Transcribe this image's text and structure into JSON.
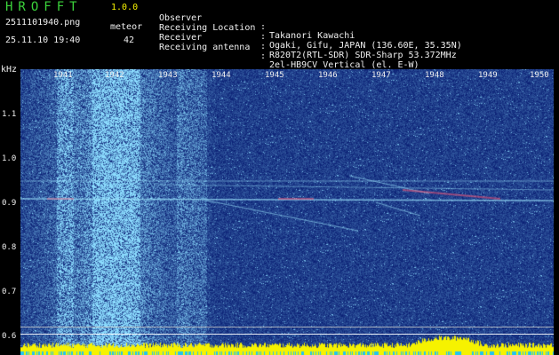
{
  "header": {
    "app_title": "HROFFT",
    "app_version": "1.0.0",
    "file_name": "2511101940.png",
    "date_time": "25.11.10 19:40",
    "meteor_label": "meteor",
    "meteor_count": "42"
  },
  "info": [
    {
      "key": "Observer",
      "sep": ":",
      "value": "Takanori Kawachi"
    },
    {
      "key": "Receiving Location",
      "sep": ":",
      "value": "Ogaki, Gifu, JAPAN (136.60E, 35.35N)"
    },
    {
      "key": "Receiver",
      "sep": ":",
      "value": "R820T2(RTL-SDR) SDR-Sharp 53.372MHz"
    },
    {
      "key": "Receiving antenna",
      "sep": ":",
      "value": "2el-HB9CV Vertical (el. E-W)"
    }
  ],
  "spectrogram": {
    "axis_unit": "kHz",
    "y_ticks": [
      "1.1",
      "1.0",
      "0.9",
      "0.8",
      "0.7",
      "0.6"
    ],
    "x_ticks": [
      "1941",
      "1942",
      "1943",
      "1944",
      "1945",
      "1946",
      "1947",
      "1948",
      "1949",
      "1950"
    ],
    "colors": {
      "background": "#0a1f74",
      "noise_bright": "#8fd8ff",
      "signal": "#9fe8ff",
      "signal_hot": "#ff5a78",
      "baseline": "#f6f200",
      "text_green": "#3bd23b",
      "text_white": "#f0f0f0"
    }
  }
}
